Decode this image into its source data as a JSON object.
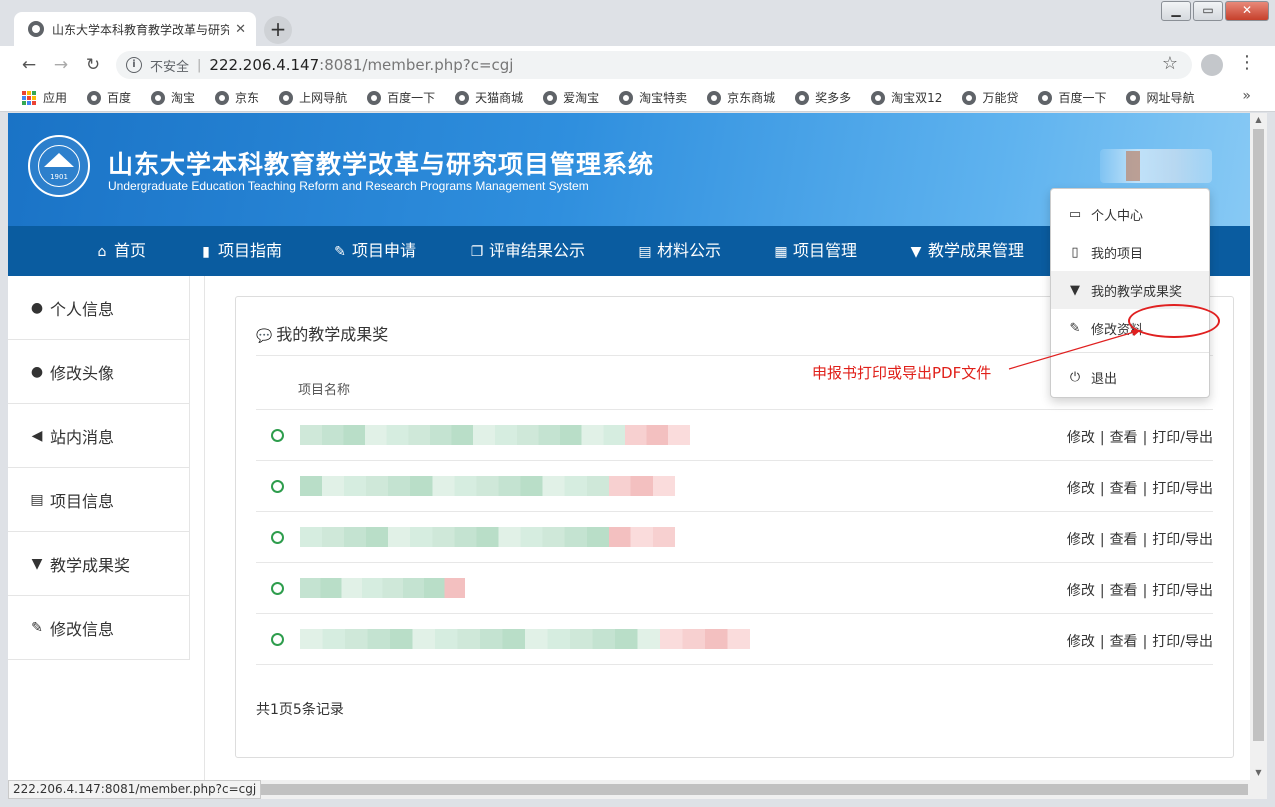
{
  "browser": {
    "tab_title": "山东大学本科教育教学改革与研究",
    "tab_close": "✕",
    "new_tab": "+",
    "not_secure": "不安全",
    "url_host": "222.206.4.147",
    "url_rest": ":8081/member.php?c=cgj",
    "status_url": "222.206.4.147:8081/member.php?c=cgj",
    "window_buttons": {
      "minimize": "▁",
      "maximize": "▭",
      "close": "✕"
    },
    "bookmarks": [
      "应用",
      "百度",
      "淘宝",
      "京东",
      "上网导航",
      "百度一下",
      "天猫商城",
      "爱淘宝",
      "淘宝特卖",
      "京东商城",
      "奖多多",
      "淘宝双12",
      "万能贷",
      "百度一下",
      "网址导航"
    ],
    "more": "»"
  },
  "header": {
    "title": "山东大学本科教育教学改革与研究项目管理系统",
    "subtitle": "Undergraduate Education Teaching Reform and Research Programs Management System",
    "seal_year": "1901"
  },
  "nav": [
    {
      "label": "首页",
      "icon": "home-icon",
      "glyph": "⌂"
    },
    {
      "label": "项目指南",
      "icon": "book-icon",
      "glyph": "▮"
    },
    {
      "label": "项目申请",
      "icon": "edit-icon",
      "glyph": "✎"
    },
    {
      "label": "评审结果公示",
      "icon": "copy-icon",
      "glyph": "❐"
    },
    {
      "label": "材料公示",
      "icon": "file-text-icon",
      "glyph": "▤"
    },
    {
      "label": "项目管理",
      "icon": "grid-icon",
      "glyph": "▦"
    },
    {
      "label": "教学成果管理",
      "icon": "trophy-icon",
      "glyph": "▼"
    }
  ],
  "sidebar": [
    {
      "label": "个人信息",
      "icon": "user-icon",
      "glyph": "●"
    },
    {
      "label": "修改头像",
      "icon": "user-icon",
      "glyph": "●"
    },
    {
      "label": "站内消息",
      "icon": "volume-icon",
      "glyph": "◀"
    },
    {
      "label": "项目信息",
      "icon": "list-icon",
      "glyph": "▤"
    },
    {
      "label": "教学成果奖",
      "icon": "trophy-icon",
      "glyph": "▼"
    },
    {
      "label": "修改信息",
      "icon": "edit-icon",
      "glyph": "✎"
    }
  ],
  "panel": {
    "title": "我的教学成果奖",
    "column_header": "项目名称",
    "actions": {
      "edit": "修改",
      "view": "查看",
      "print": "打印/导出",
      "separator": "|"
    },
    "pager": "共1页5条记录"
  },
  "rows": [
    {
      "blur_width": 390
    },
    {
      "blur_width": 375
    },
    {
      "blur_width": 375
    },
    {
      "blur_width": 165
    },
    {
      "blur_width": 450
    }
  ],
  "dropdown": [
    {
      "label": "个人中心",
      "icon": "inbox-icon",
      "glyph": "▭",
      "active": false
    },
    {
      "label": "我的项目",
      "icon": "file-icon",
      "glyph": "▯",
      "active": false
    },
    {
      "label": "我的教学成果奖",
      "icon": "trophy-icon",
      "glyph": "▼",
      "active": true
    },
    {
      "label": "修改资料",
      "icon": "wrench-icon",
      "glyph": "✎",
      "active": false
    },
    {
      "label": "退出",
      "icon": "power-icon",
      "glyph": "⏻",
      "active": false
    }
  ],
  "annotation": {
    "text": "申报书打印或导出PDF文件",
    "color": "#e0201a"
  },
  "colors": {
    "nav": "#0a5ca0",
    "hero": "#1a73c6",
    "dot": "#2e9d4d"
  }
}
